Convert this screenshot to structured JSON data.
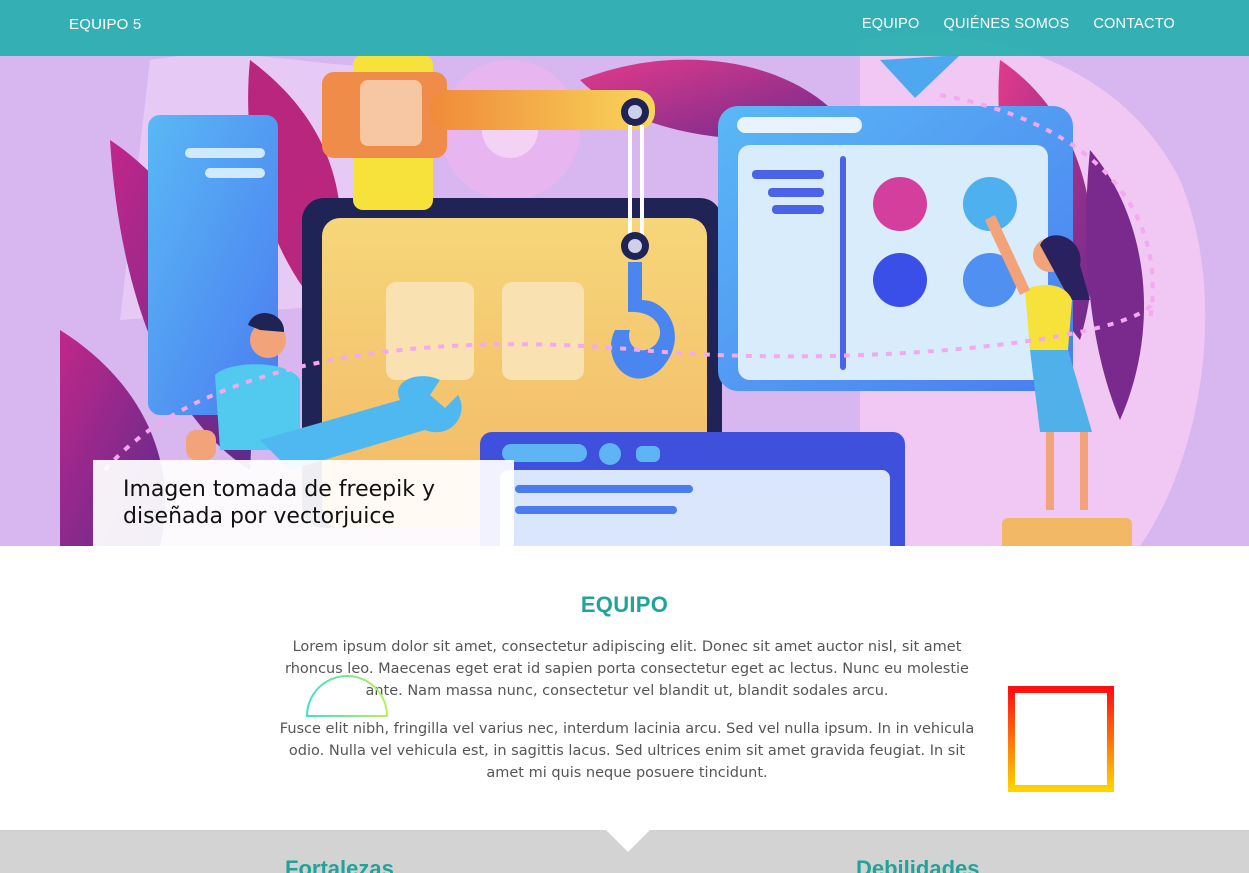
{
  "navbar": {
    "brand": "EQUIPO 5",
    "links": [
      "EQUIPO",
      "QUIÉNES SOMOS",
      "CONTACTO"
    ]
  },
  "hero": {
    "caption": "Imagen tomada de freepik y diseñada por vectorjuice"
  },
  "equipo": {
    "title": "EQUIPO",
    "paragraph_1": "Lorem ipsum dolor sit amet, consectetur adipiscing elit. Donec sit amet auctor nisl, sit amet rhoncus leo. Maecenas eget erat id sapien porta consectetur eget ac lectus. Nunc eu molestie ante. Nam massa nunc, consectetur vel blandit ut, blandit sodales arcu.",
    "paragraph_2": "Fusce elit nibh, fringilla vel varius nec, interdum lacinia arcu. Sed vel nulla ipsum. In in vehicula odio. Nulla vel vehicula est, in sagittis lacus. Sed ultrices enim sit amet gravida feugiat. In sit amet mi quis neque posuere tincidunt."
  },
  "band": {
    "left_heading": "Fortalezas",
    "right_heading": "Debilidades"
  },
  "colors": {
    "navbar": "#26b0b0",
    "accent_teal": "#20a39a",
    "band_gray": "#d3d3d3"
  }
}
